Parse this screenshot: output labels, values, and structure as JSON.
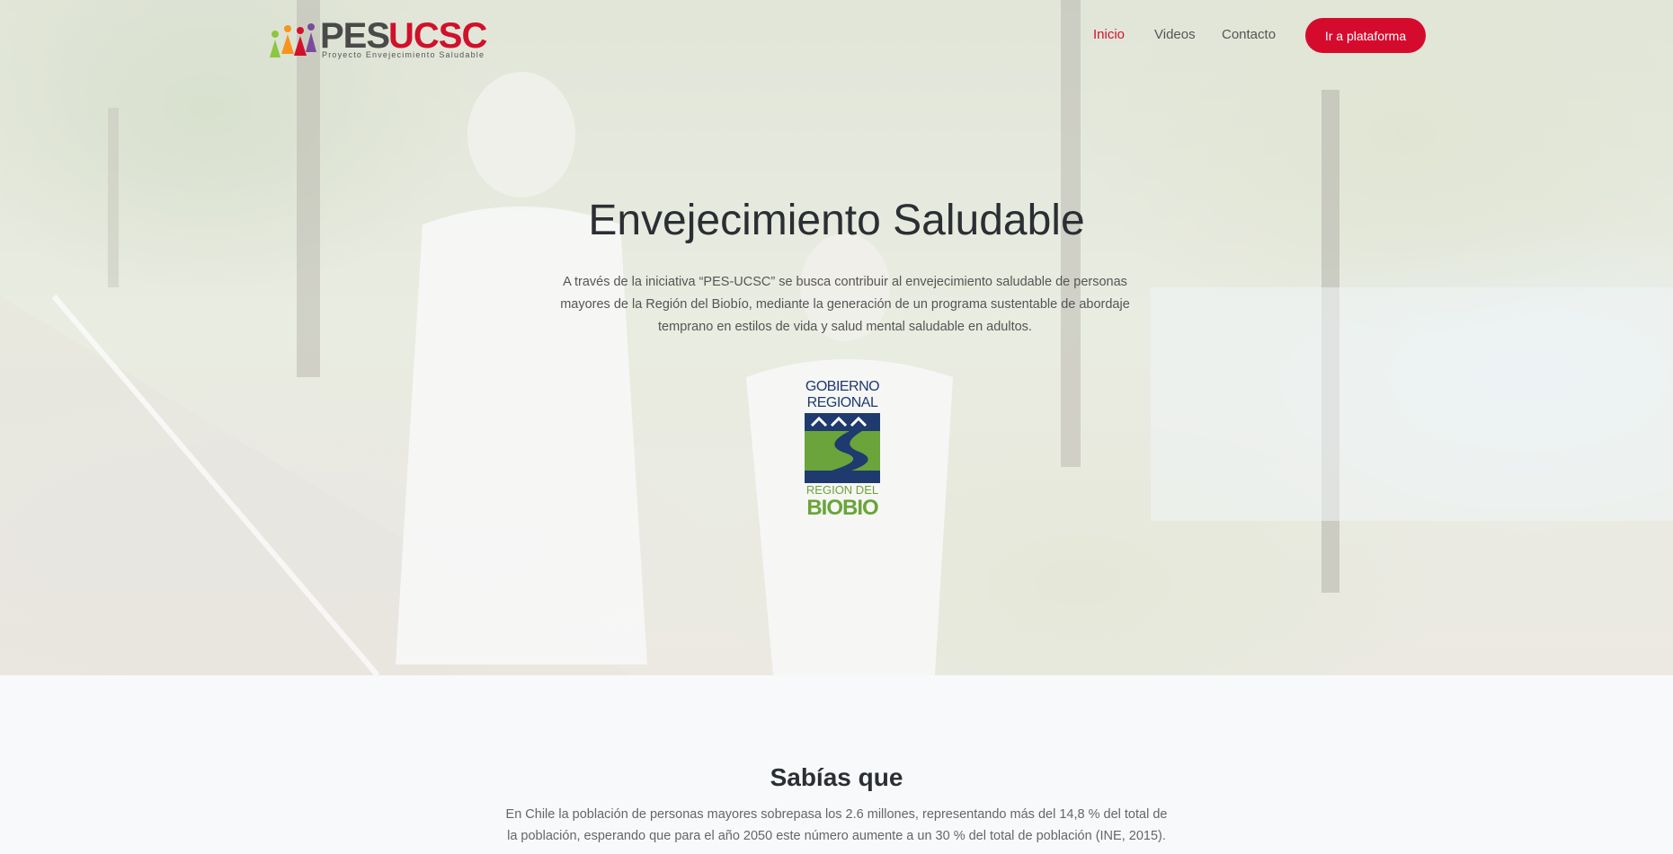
{
  "nav": {
    "logo": {
      "main": "PES",
      "accent": "UCSC",
      "tagline": "Proyecto Envejecimiento Saludable"
    },
    "links": [
      {
        "label": "Inicio",
        "active": true
      },
      {
        "label": "Videos",
        "active": false
      },
      {
        "label": "Contacto",
        "active": false
      }
    ],
    "cta_label": "Ir a plataforma"
  },
  "hero": {
    "title": "Envejecimiento Saludable",
    "text": "A través de la iniciativa “PES-UCSC” se busca contribuir al envejecimiento saludable de personas mayores de la Región del Biobío, mediante la generación de un programa sustentable de abordaje temprano en estilos de vida y salud mental saludable en adultos.",
    "partner_logo": {
      "line1": "GOBIERNO",
      "line2": "REGIONAL",
      "line3": "REGION DEL",
      "line4": "BIOBIO"
    }
  },
  "facts": {
    "title": "Sabías que",
    "text": "En Chile la población de personas mayores sobrepasa los 2.6 millones, representando más del 14,8 % del total de la población, esperando que para el año 2050 este número aumente a un 30 % del total de población (INE, 2015)."
  },
  "colors": {
    "accent": "#d50b2e",
    "navy": "#1f3a6e",
    "green": "#6aa43a"
  }
}
